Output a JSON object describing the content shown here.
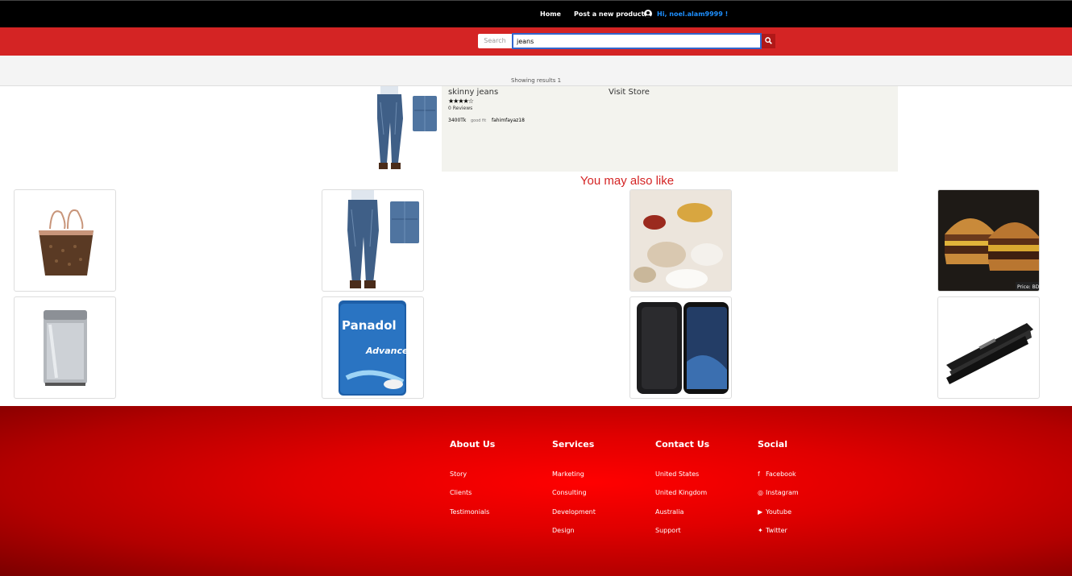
{
  "nav": {
    "home": "Home",
    "post": "Post a new product",
    "greeting": "Hi, noel.alam9999 !"
  },
  "search": {
    "label": "Search",
    "value": "jeans"
  },
  "results": {
    "text": "Showing results 1"
  },
  "product": {
    "title": "skinny jeans",
    "stars": "★★★★☆",
    "rating": 4,
    "reviews": "0 Reviews",
    "price": "3400Tk",
    "tag": "good fit",
    "seller": "fahimfayaz18",
    "visit": "Visit Store"
  },
  "also_like": {
    "title": "You may also like",
    "items": [
      "handbag",
      "jeans",
      "pills",
      "burger",
      "washing-machine",
      "panadol",
      "phone",
      "stapler"
    ]
  },
  "colors": {
    "brand_red": "#d42424",
    "nav_black": "#000000"
  },
  "footer": {
    "about": {
      "title": "About Us",
      "links": [
        "Story",
        "Clients",
        "Testimonials"
      ]
    },
    "services": {
      "title": "Services",
      "links": [
        "Marketing",
        "Consulting",
        "Development",
        "Design"
      ]
    },
    "contact": {
      "title": "Contact Us",
      "links": [
        "United States",
        "United Kingdom",
        "Australia",
        "Support"
      ]
    },
    "social": {
      "title": "Social",
      "links": [
        "Facebook",
        "Instagram",
        "Youtube",
        "Twitter"
      ]
    }
  }
}
